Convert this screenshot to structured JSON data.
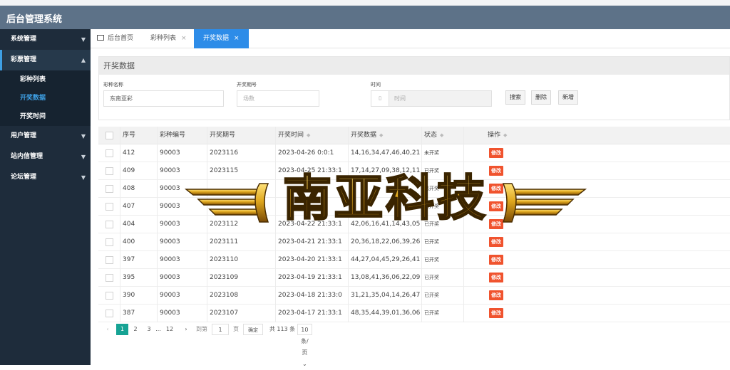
{
  "app": {
    "title": "后台管理系统"
  },
  "sidebar": {
    "items": [
      {
        "label": "系统管理",
        "caret": "▼"
      },
      {
        "label": "彩票管理",
        "caret": "▲"
      },
      {
        "label": "用户管理",
        "caret": "▼"
      },
      {
        "label": "站内信管理",
        "caret": "▼"
      },
      {
        "label": "论坛管理",
        "caret": "▼"
      }
    ],
    "sub_items": [
      {
        "label": "彩种列表"
      },
      {
        "label": "开奖数据"
      },
      {
        "label": "开奖时间"
      }
    ]
  },
  "tabs": [
    {
      "label": "后台首页"
    },
    {
      "label": "彩种列表",
      "close": "×"
    },
    {
      "label": "开奖数据",
      "close": "×"
    }
  ],
  "panel": {
    "title": "开奖数据",
    "lottery_name_label": "彩种名称",
    "lottery_name_value": "东南亚彩",
    "issue_label": "开奖期号",
    "issue_placeholder": "场数",
    "time_label": "时间",
    "time_placeholder": "时间",
    "search_button": "搜索",
    "delete_button": "删除",
    "add_button": "新增"
  },
  "table": {
    "columns": [
      "序号",
      "彩种编号",
      "开奖期号",
      "开奖时间",
      "开奖数据",
      "状态",
      "操作"
    ],
    "edit_label": "修改",
    "rows": [
      {
        "id": "412",
        "code": "90003",
        "issue": "2023116",
        "time": "2023-04-26 0:0:1",
        "numbers": "14,16,34,47,46,40,21",
        "status": "未开奖"
      },
      {
        "id": "409",
        "code": "90003",
        "issue": "2023115",
        "time": "2023-04-25 21:33:1",
        "numbers": "17,14,27,09,38,12,11",
        "status": "已开奖"
      },
      {
        "id": "408",
        "code": "90003",
        "issue": "",
        "time": "",
        "numbers": "",
        "status": "已开奖"
      },
      {
        "id": "407",
        "code": "90003",
        "issue": "",
        "time": "",
        "numbers": "",
        "status": "已开奖"
      },
      {
        "id": "404",
        "code": "90003",
        "issue": "2023112",
        "time": "2023-04-22 21:33:1",
        "numbers": "42,06,16,41,14,43,05",
        "status": "已开奖"
      },
      {
        "id": "400",
        "code": "90003",
        "issue": "2023111",
        "time": "2023-04-21 21:33:1",
        "numbers": "20,36,18,22,06,39,26",
        "status": "已开奖"
      },
      {
        "id": "397",
        "code": "90003",
        "issue": "2023110",
        "time": "2023-04-20 21:33:1",
        "numbers": "44,27,04,45,29,26,41",
        "status": "已开奖"
      },
      {
        "id": "395",
        "code": "90003",
        "issue": "2023109",
        "time": "2023-04-19 21:33:1",
        "numbers": "13,08,41,36,06,22,09",
        "status": "已开奖"
      },
      {
        "id": "390",
        "code": "90003",
        "issue": "2023108",
        "time": "2023-04-18 21:33:0",
        "numbers": "31,21,35,04,14,26,47",
        "status": "已开奖"
      },
      {
        "id": "387",
        "code": "90003",
        "issue": "2023107",
        "time": "2023-04-17 21:33:1",
        "numbers": "48,35,44,39,01,36,06",
        "status": "已开奖"
      }
    ]
  },
  "pagination": {
    "prev": "‹",
    "pages": [
      "1",
      "2",
      "3"
    ],
    "ellipsis": "...",
    "last": "12",
    "next": "›",
    "goto_label": "到第",
    "goto_value": "1",
    "page_unit": "页",
    "confirm": "确定",
    "total": "共 113 条",
    "page_size": "10 条/页"
  },
  "watermark": {
    "text": "南亚科技"
  },
  "colors": {
    "header": "#5d7288",
    "sidebar": "#1e2c3b",
    "accent": "#2d8ce8",
    "edit": "#f0532e",
    "page_current": "#16a394"
  }
}
